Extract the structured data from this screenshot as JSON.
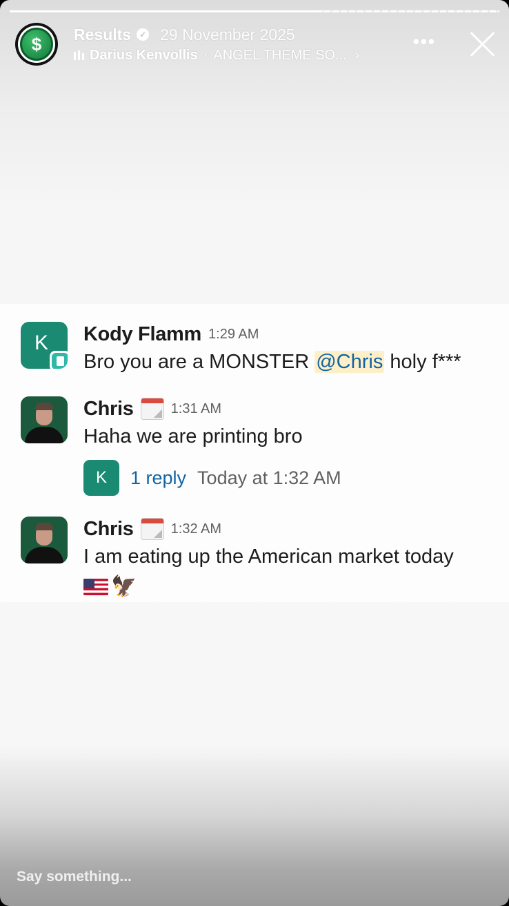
{
  "story": {
    "progress_fraction": 0.64,
    "account_name": "Results",
    "date": "29 November 2025",
    "music": {
      "artist": "Darius Kenvollis",
      "song": "ANGEL THEME SO..."
    },
    "reply_placeholder": "Say something...",
    "icons": [
      "dollar-coin-icon",
      "verified-icon",
      "music-bars-icon",
      "chevron-right-icon",
      "more-icon",
      "close-icon"
    ]
  },
  "chat": {
    "messages": [
      {
        "author": "Kody Flamm",
        "time": "1:29 AM",
        "avatar_letter": "K",
        "text_before": "Bro you are a MONSTER ",
        "mention": "@Chris",
        "text_after": " holy f***"
      },
      {
        "author": "Chris",
        "time": "1:31 AM",
        "status_icon": "calendar-icon",
        "text": "Haha we are printing bro",
        "thread": {
          "avatar_letter": "K",
          "reply_count": "1 reply",
          "last_reply": "Today at 1:32 AM"
        }
      },
      {
        "author": "Chris",
        "time": "1:32 AM",
        "status_icon": "calendar-icon",
        "text": "I am eating up the American market today",
        "emojis": [
          "us-flag-emoji",
          "eagle-emoji"
        ]
      }
    ],
    "colors": {
      "accent": "#1a8a73",
      "link": "#1264a3",
      "mention_bg": "#fdf0c9"
    }
  }
}
